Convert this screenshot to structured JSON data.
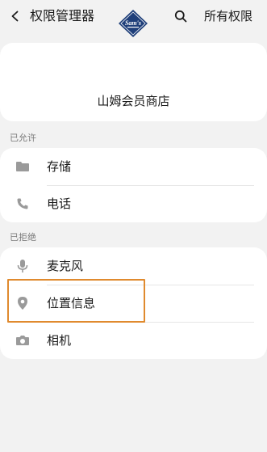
{
  "header": {
    "title": "权限管理器",
    "all_permissions": "所有权限",
    "back_icon": "back-arrow-icon",
    "search_icon": "search-icon"
  },
  "app": {
    "name": "山姆会员商店",
    "logo_text": "Sam's",
    "logo_icon": "sams-club-logo"
  },
  "sections": {
    "allowed_label": "已允许",
    "denied_label": "已拒绝"
  },
  "allowed": [
    {
      "label": "存储",
      "icon": "folder-icon"
    },
    {
      "label": "电话",
      "icon": "phone-icon"
    }
  ],
  "denied": [
    {
      "label": "麦克风",
      "icon": "microphone-icon"
    },
    {
      "label": "位置信息",
      "icon": "location-pin-icon"
    },
    {
      "label": "相机",
      "icon": "camera-icon"
    }
  ],
  "colors": {
    "background": "#f2f2f2",
    "card": "#ffffff",
    "icon_gray": "#9a9a9a",
    "highlight": "#e08a2e",
    "logo_blue": "#1f3f7a"
  }
}
